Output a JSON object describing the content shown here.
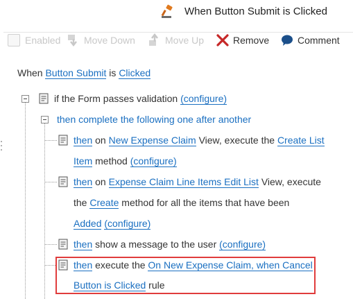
{
  "title": {
    "text": "When Button Submit is Clicked",
    "icon": "gavel-icon"
  },
  "toolbar": {
    "enabled": "Enabled",
    "move_down": "Move Down",
    "move_up": "Move Up",
    "remove": "Remove",
    "comment": "Comment"
  },
  "event": {
    "when": "When",
    "control": "Button Submit",
    "is": "is",
    "event": "Clicked"
  },
  "condition": {
    "text": "if the Form passes validation",
    "configure": "(configure)"
  },
  "block": {
    "text": "then complete the following one after another"
  },
  "actions": [
    {
      "then": "then",
      "on": "on",
      "view": "New Expense Claim",
      "mid": "View, execute the",
      "method_1": "Create List",
      "method_2": "Item",
      "tail": "method",
      "configure": "(configure)"
    },
    {
      "then": "then",
      "on": "on",
      "view": "Expense Claim Line Items Edit List",
      "mid": "View, execute",
      "the": "the",
      "method": "Create",
      "tail": "method for all the items that have been",
      "state": "Added",
      "configure": "(configure)"
    },
    {
      "then": "then",
      "text": "show a message to the user",
      "configure": "(configure)"
    },
    {
      "then": "then",
      "text": "execute the",
      "rule_1": "On New Expense Claim, when Cancel",
      "rule_2": "Button is Clicked",
      "tail": "rule"
    }
  ],
  "colors": {
    "link": "#1a6fc1",
    "highlight": "#e03c3c",
    "remove": "#c62828"
  }
}
